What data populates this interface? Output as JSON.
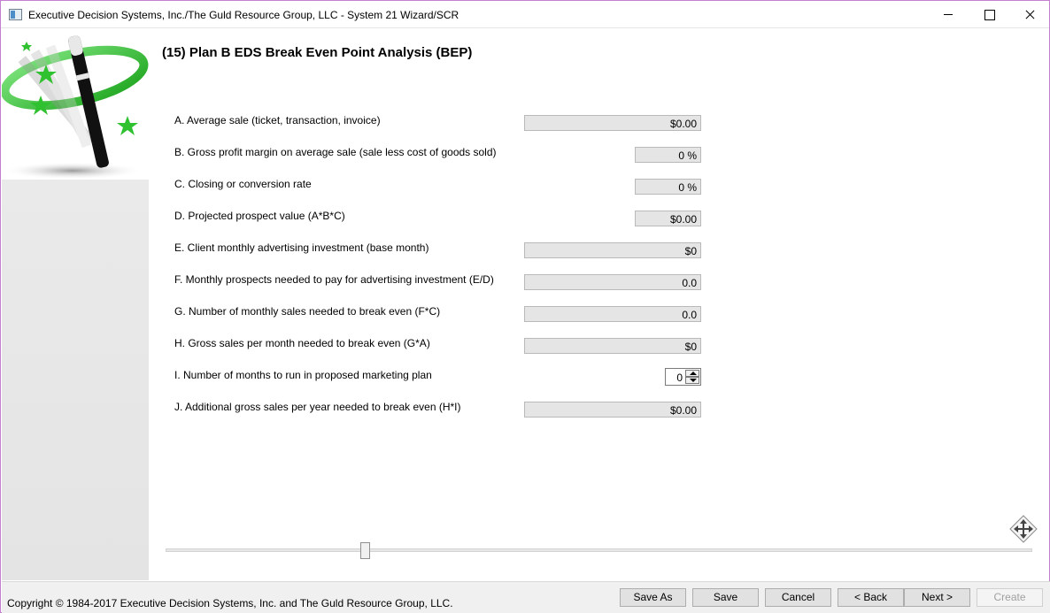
{
  "window": {
    "title": "Executive Decision Systems, Inc./The Guld Resource Group, LLC - System 21 Wizard/SCR"
  },
  "page": {
    "title": "(15) Plan B EDS Break Even Point Analysis (BEP)"
  },
  "rows": [
    {
      "label": "A. Average sale (ticket, transaction, invoice)",
      "value": "$0.00"
    },
    {
      "label": "B. Gross profit margin on average sale (sale less cost of goods sold)",
      "value": "0 %"
    },
    {
      "label": "C. Closing or conversion rate",
      "value": "0 %"
    },
    {
      "label": "D. Projected prospect value (A*B*C)",
      "value": "$0.00"
    },
    {
      "label": "E. Client monthly advertising investment (base month)",
      "value": "$0"
    },
    {
      "label": "F. Monthly prospects needed to pay for advertising investment (E/D)",
      "value": "0.0"
    },
    {
      "label": "G. Number of monthly sales needed to break even (F*C)",
      "value": "0.0"
    },
    {
      "label": "H. Gross sales per month needed to break even (G*A)",
      "value": "$0"
    },
    {
      "label": "I. Number of months to run in proposed marketing plan",
      "value": "0"
    },
    {
      "label": "J. Additional gross sales per year needed to break even (H*I)",
      "value": "$0.00"
    }
  ],
  "slider": {
    "position_percent": 23
  },
  "footer": {
    "copyright": "Copyright © 1984-2017 Executive Decision Systems, Inc. and The Guld Resource Group, LLC.",
    "buttons": {
      "save_as": "Save As",
      "save": "Save",
      "cancel": "Cancel",
      "back": "< Back",
      "next": "Next >",
      "create": "Create"
    }
  },
  "icons": {
    "logo": "magic-wand-icon",
    "move": "move-arrows-icon"
  },
  "colors": {
    "window_border": "#c47fd0",
    "field_bg": "#e5e5e5",
    "logo_green": "#2fc12f"
  }
}
